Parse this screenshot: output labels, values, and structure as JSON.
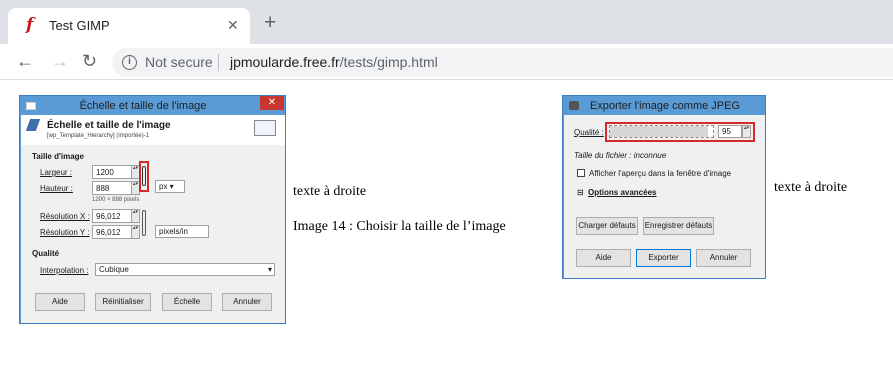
{
  "browser": {
    "tab_title": "Test GIMP",
    "tab_favicon": "f",
    "tab_close": "✕",
    "new_tab": "+",
    "back": "←",
    "forward": "→",
    "reload": "↻",
    "security_label": "Not secure",
    "url_host": "jpmoularde.free.fr",
    "url_path": "/tests/gimp.html"
  },
  "dialog_scale": {
    "window_title": "Échelle et taille de l'image",
    "header_title": "Échelle et taille de l'image",
    "header_subtitle": "[wp_Template_Hierarchy] (importée)-1",
    "section_size": "Taille d'image",
    "width_label": "Largeur :",
    "width_value": "1200",
    "height_label": "Hauteur :",
    "height_value": "888",
    "unit_value": "px",
    "size_note": "1200 × 888 pixels",
    "res_x_label": "Résolution X :",
    "res_x_value": "96,012",
    "res_y_label": "Résolution Y :",
    "res_y_value": "96,012",
    "res_unit": "pixels/in",
    "section_quality": "Qualité",
    "interp_label": "Interpolation :",
    "interp_value": "Cubique",
    "buttons": [
      "Aide",
      "Réinitialiser",
      "Échelle",
      "Annuler"
    ]
  },
  "dialog_jpeg": {
    "window_title": "Exporter l'image comme JPEG",
    "quality_label": "Qualité :",
    "quality_value": "95",
    "quality_level": 0.95,
    "file_size": "Taille du fichier : inconnue",
    "preview_label": "Afficher l'aperçu dans la fenêtre d'image",
    "advanced_label": "Options avancées",
    "load_defaults": "Charger défauts",
    "save_defaults": "Enregistrer défauts",
    "buttons": [
      "Aide",
      "Exporter",
      "Annuler"
    ]
  },
  "page": {
    "text_right_1": "texte à droite",
    "caption": "Image 14 : Choisir la taille de l’image",
    "text_right_2": "texte à droite"
  },
  "colors": {
    "win_border": "#5b9bd5",
    "close_red": "#c7362f",
    "highlight_red": "#d42a2a"
  }
}
